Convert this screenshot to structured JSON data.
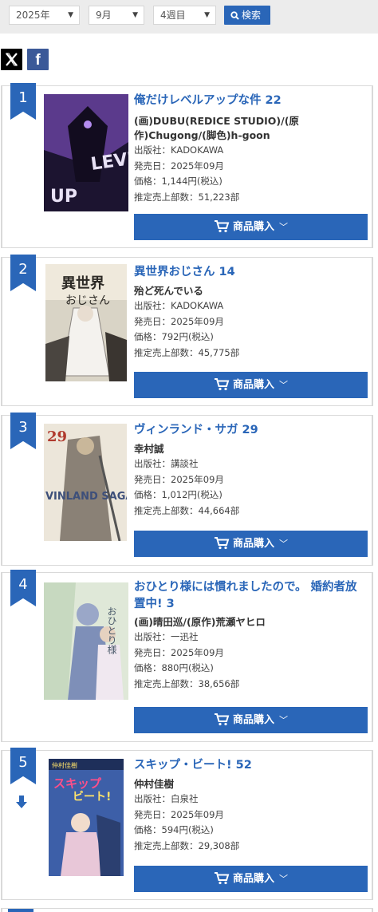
{
  "filters": {
    "year": "2025年",
    "month": "9月",
    "week": "4週目",
    "search_label": "検索"
  },
  "social": {
    "x": "X",
    "facebook": "f"
  },
  "labels": {
    "publisher": "出版社：",
    "release": "発売日：",
    "price": "価格：",
    "sales": "推定売上部数：",
    "buy": "商品購入"
  },
  "items": [
    {
      "rank": "1",
      "title": "俺だけレベルアップな件 22",
      "author": "(画)DUBU(REDICE STUDIO)/(原作)Chugong/(脚色)h-goon",
      "publisher": "KADOKAWA",
      "release": "2025年09月",
      "price": "1,144円(税込)",
      "sales": "51,223部",
      "cover_colors": [
        "#5b3a8c",
        "#1c1430"
      ],
      "trend": ""
    },
    {
      "rank": "2",
      "title": "異世界おじさん 14",
      "author": "殆ど死んでいる",
      "publisher": "KADOKAWA",
      "release": "2025年09月",
      "price": "792円(税込)",
      "sales": "45,775部",
      "cover_colors": [
        "#d9d4c6",
        "#3a3530"
      ],
      "trend": ""
    },
    {
      "rank": "3",
      "title": "ヴィンランド・サガ 29",
      "author": "幸村誠",
      "publisher": "講談社",
      "release": "2025年09月",
      "price": "1,012円(税込)",
      "sales": "44,664部",
      "cover_colors": [
        "#ece6da",
        "#8a8176"
      ],
      "trend": ""
    },
    {
      "rank": "4",
      "title": "おひとり様には慣れましたので。 婚約者放置中! 3",
      "author": "(画)晴田巡/(原作)荒瀬ヤヒロ",
      "publisher": "一迅社",
      "release": "2025年09月",
      "price": "880円(税込)",
      "sales": "38,656部",
      "cover_colors": [
        "#dfe8d8",
        "#9aa7c8"
      ],
      "trend": ""
    },
    {
      "rank": "5",
      "title": "スキップ・ビート! 52",
      "author": "仲村佳樹",
      "publisher": "白泉社",
      "release": "2025年09月",
      "price": "594円(税込)",
      "sales": "29,308部",
      "cover_colors": [
        "#3d5fa8",
        "#e8c7d8"
      ],
      "trend": "down-arrow-icon"
    }
  ]
}
